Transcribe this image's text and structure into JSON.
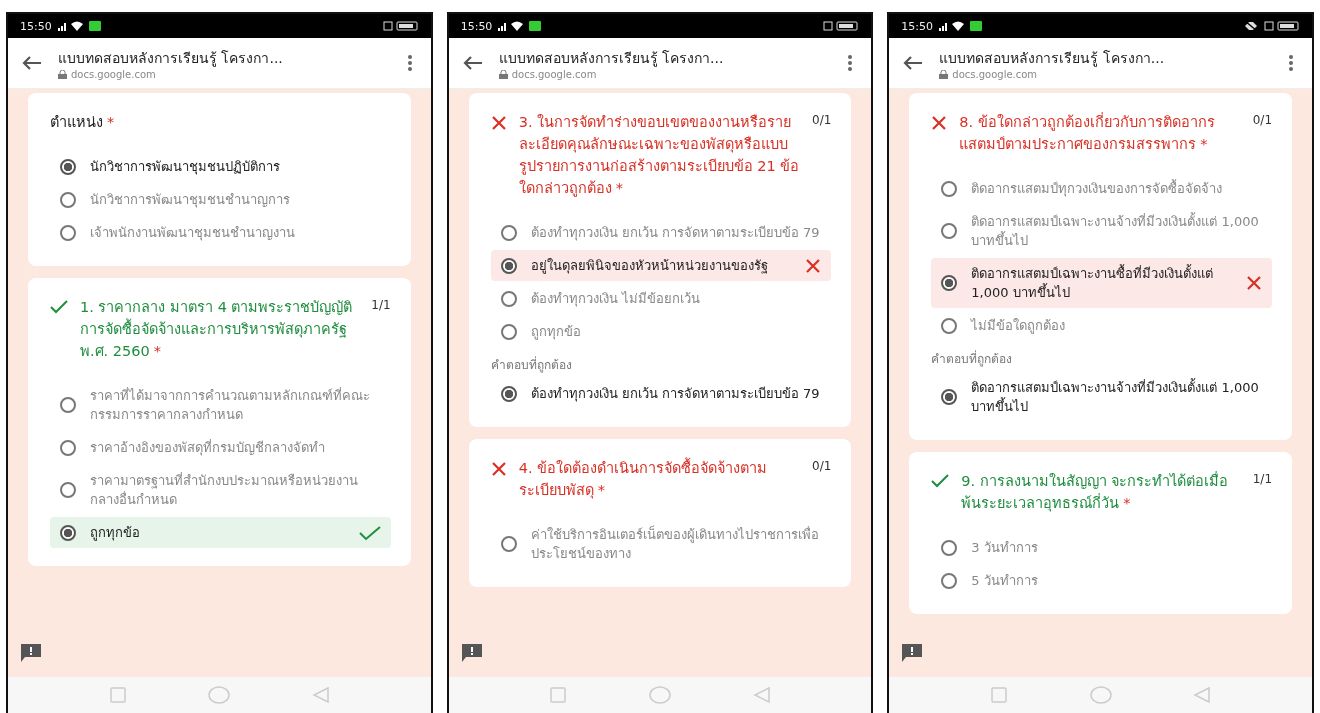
{
  "phones": [
    {
      "status_bar": {
        "time": "15:50"
      },
      "header": {
        "title": "แบบทดสอบหลังการเรียนรู้ โครงกา...",
        "url": "docs.google.com"
      },
      "cards": [
        {
          "title": "ตำแหน่ง",
          "required_mark": "*",
          "options": [
            {
              "label": "นักวิชาการพัฒนาชุมชนปฏิบัติการ",
              "selected": true
            },
            {
              "label": "นักวิชาการพัฒนาชุมชนชำนาญการ",
              "selected": false
            },
            {
              "label": "เจ้าพนักงานพัฒนาชุมชนชำนาญงาน",
              "selected": false
            }
          ]
        },
        {
          "correct": true,
          "title": "1. ราคากลาง มาตรา 4 ตามพระราชบัญญัติการจัดซื้อจัดจ้างและการบริหารพัสดุภาครัฐ พ.ศ. 2560",
          "score": "1/1",
          "required_mark": "*",
          "options": [
            {
              "label": "ราคาที่ได้มาจากการคำนวณตามหลักเกณฑ์ที่คณะกรรมการราคากลางกำหนด",
              "selected": false
            },
            {
              "label": "ราคาอ้างอิงของพัสดุที่กรมบัญชีกลางจัดทำ",
              "selected": false
            },
            {
              "label": "ราคามาตรฐานที่สำนักงบประมาณหรือหน่วยงานกลางอื่นกำหนด",
              "selected": false
            },
            {
              "label": "ถูกทุกข้อ",
              "selected": true,
              "correct": true
            }
          ]
        }
      ]
    },
    {
      "status_bar": {
        "time": "15:50"
      },
      "header": {
        "title": "แบบทดสอบหลังการเรียนรู้ โครงกา...",
        "url": "docs.google.com"
      },
      "cards": [
        {
          "correct": false,
          "title": "3. ในการจัดทำร่างขอบเขตของงานหรือรายละเอียดคุณลักษณะเฉพาะของพัสดุหรือแบบรูปรายการงานก่อสร้างตามระเบียบข้อ 21 ข้อใดกล่าวถูกต้อง",
          "score": "0/1",
          "required_mark": "*",
          "options": [
            {
              "label": "ต้องทำทุกวงเงิน ยกเว้น การจัดหาตามระเบียบข้อ 79",
              "selected": false
            },
            {
              "label": "อยู่ในดุลยพินิจของหัวหน้าหน่วยงานของรัฐ",
              "selected": true,
              "correct": false
            },
            {
              "label": "ต้องทำทุกวงเงิน ไม่มีข้อยกเว้น",
              "selected": false
            },
            {
              "label": "ถูกทุกข้อ",
              "selected": false
            }
          ],
          "correct_answer": {
            "heading": "คำตอบที่ถูกต้อง",
            "label": "ต้องทำทุกวงเงิน ยกเว้น การจัดหาตามระเบียบข้อ 79",
            "selected": true
          }
        },
        {
          "correct": false,
          "title": "4. ข้อใดต้องดำเนินการจัดซื้อจัดจ้างตามระเบียบพัสดุ",
          "score": "0/1",
          "required_mark": "*",
          "options": [
            {
              "label": "ค่าใช้บริการอินเตอร์เน็ตของผู้เดินทางไปราชการเพื่อประโยชน์ของทาง",
              "selected": false
            }
          ]
        }
      ]
    },
    {
      "status_bar": {
        "time": "15:50",
        "rotation_icon": true
      },
      "header": {
        "title": "แบบทดสอบหลังการเรียนรู้ โครงกา...",
        "url": "docs.google.com"
      },
      "cards": [
        {
          "correct": false,
          "title": "8. ข้อใดกล่าวถูกต้องเกี่ยวกับการติดอากรแสตมป์ตามประกาศของกรมสรรพากร",
          "score": "0/1",
          "required_mark": "*",
          "options": [
            {
              "label": "ติดอากรแสตมป์ทุกวงเงินของการจัดซื้อจัดจ้าง",
              "selected": false
            },
            {
              "label": "ติดอากรแสตมป์เฉพาะงานจ้างที่มีวงเงินตั้งแต่ 1,000 บาทขึ้นไป",
              "selected": false
            },
            {
              "label": "ติดอากรแสตมป์เฉพาะงานซื้อที่มีวงเงินตั้งแต่ 1,000 บาทขึ้นไป",
              "selected": true,
              "correct": false
            },
            {
              "label": "ไม่มีข้อใดถูกต้อง",
              "selected": false
            }
          ],
          "correct_answer": {
            "heading": "คำตอบที่ถูกต้อง",
            "label": "ติดอากรแสตมป์เฉพาะงานจ้างที่มีวงเงินตั้งแต่ 1,000 บาทขึ้นไป",
            "selected": true
          }
        },
        {
          "correct": true,
          "title": "9. การลงนามในสัญญา จะกระทำได้ต่อเมื่อพ้นระยะเวลาอุทธรณ์กี่วัน",
          "score": "1/1",
          "required_mark": "*",
          "options": [
            {
              "label": "3 วันทำการ",
              "selected": false
            },
            {
              "label": "5 วันทำการ",
              "selected": false
            }
          ]
        }
      ]
    }
  ]
}
